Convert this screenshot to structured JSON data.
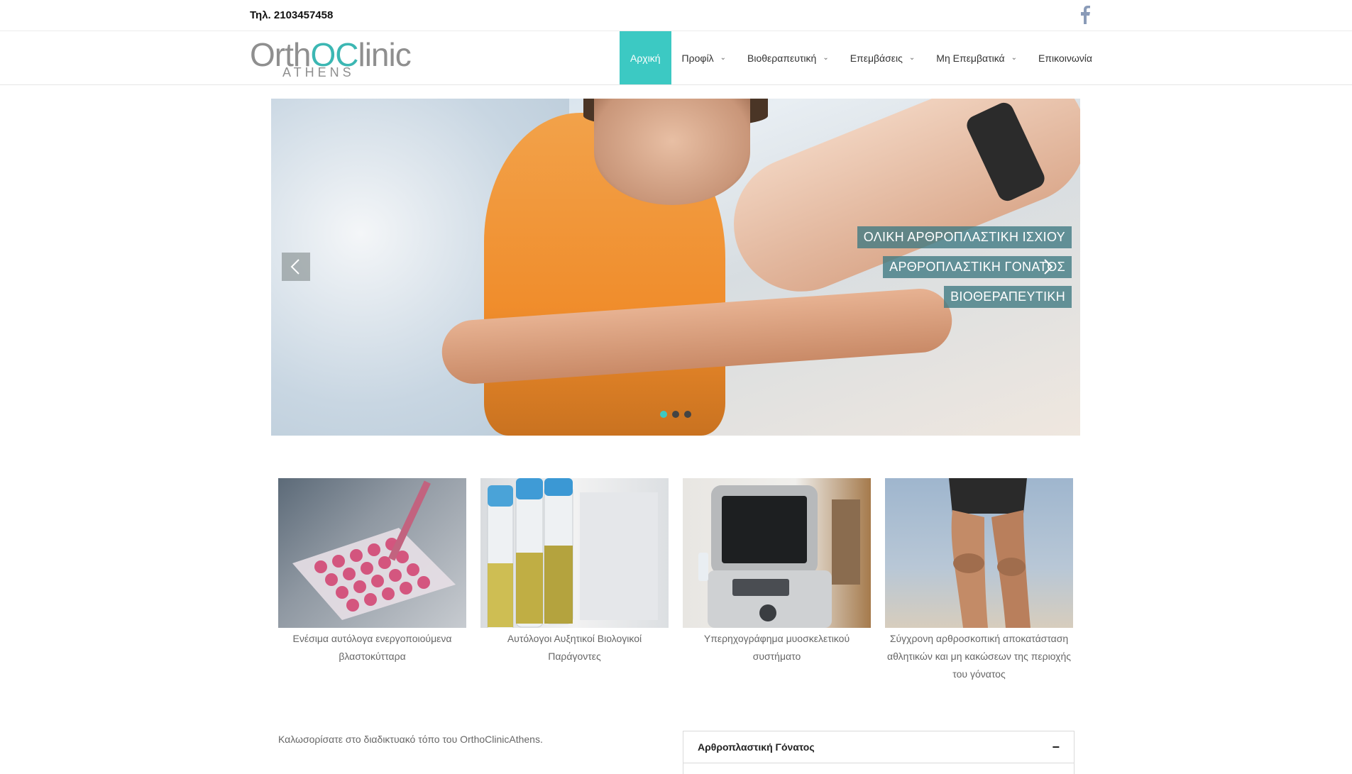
{
  "topbar": {
    "phone": "Τηλ. 2103457458"
  },
  "logo": {
    "main_part1": "Orth",
    "main_part2": "OC",
    "main_part3": "linic",
    "sub": "ATHENS"
  },
  "nav": {
    "items": [
      {
        "label": "Αρχική",
        "active": true
      },
      {
        "label": "Προφίλ",
        "dropdown": true
      },
      {
        "label": "Βιοθεραπευτική",
        "dropdown": true
      },
      {
        "label": "Επεμβάσεις",
        "dropdown": true
      },
      {
        "label": "Μη Επεμβατικά",
        "dropdown": true
      },
      {
        "label": "Επικοινωνία"
      }
    ]
  },
  "slider": {
    "tags": [
      "ΟΛΙΚΗ ΑΡΘΡΟΠΛΑΣΤΙΚΗ ΙΣΧΙΟΥ",
      "ΑΡΘΡΟΠΛΑΣΤΙΚΗ ΓΟΝΑΤΟΣ",
      "ΒΙΟΘΕΡΑΠΕΥΤΙΚΗ"
    ],
    "active_slide": 1,
    "slide_count": 3
  },
  "tiles": [
    {
      "caption": "Ενέσιμα αυτόλογα ενεργοποιούμενα βλαστοκύτταρα"
    },
    {
      "caption": "Αυτόλογοι Αυξητικοί Βιολογικοί Παράγοντες"
    },
    {
      "caption": "Υπερηχογράφημα μυοσκελετικού συστήματο"
    },
    {
      "caption": "Σύγχρονη αρθροσκοπική αποκατάσταση αθλητικών και μη κακώσεων της περιοχής του γόνατος"
    }
  ],
  "welcome": "Καλωσορίσατε στο διαδικτυακό τόπο του OrthoClinicAthens.",
  "accordion": {
    "title": "Αρθροπλαστική Γόνατος",
    "toggle": "−"
  },
  "colors": {
    "accent": "#3cc9c3",
    "tag_bg": "#3d7882"
  }
}
